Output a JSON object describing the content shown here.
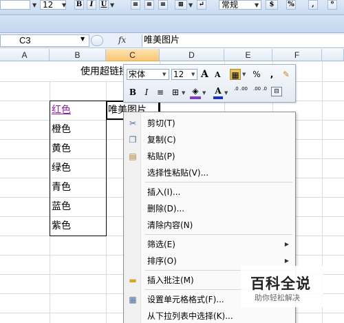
{
  "ribbon": {
    "font_size": "12",
    "bold": "B",
    "italic": "I",
    "underline": "U",
    "number_format": "常规",
    "percent": "%",
    "comma": ","
  },
  "formula_bar": {
    "name_box": "C3",
    "fx": "fx",
    "content": "唯美图片"
  },
  "columns": [
    "A",
    "B",
    "C",
    "D",
    "E",
    "F"
  ],
  "selected_column": "C",
  "sheet": {
    "title": "使用超链接",
    "items": [
      "红色",
      "橙色",
      "黄色",
      "绿色",
      "青色",
      "蓝色",
      "紫色"
    ],
    "active_cell": "唯美图片"
  },
  "mini_toolbar": {
    "font_name": "宋体",
    "font_size": "12",
    "grow_font": "A",
    "shrink_font": "A",
    "percent": "%",
    "comma": ",",
    "bold": "B",
    "italic": "I",
    "font_color": "A",
    "inc_decimal": ".0 .00",
    "dec_decimal": ".00 .0"
  },
  "context_menu": {
    "items": [
      {
        "label": "剪切(T)",
        "icon": "scissors-icon",
        "submenu": false
      },
      {
        "label": "复制(C)",
        "icon": "copy-icon",
        "submenu": false
      },
      {
        "label": "粘贴(P)",
        "icon": "paste-icon",
        "submenu": false
      },
      {
        "label": "选择性粘贴(V)...",
        "icon": "",
        "submenu": false
      },
      {
        "label": "插入(I)...",
        "icon": "",
        "submenu": false
      },
      {
        "label": "删除(D)...",
        "icon": "",
        "submenu": false
      },
      {
        "label": "清除内容(N)",
        "icon": "",
        "submenu": false
      },
      {
        "label": "筛选(E)",
        "icon": "",
        "submenu": true
      },
      {
        "label": "排序(O)",
        "icon": "",
        "submenu": true
      },
      {
        "label": "插入批注(M)",
        "icon": "comment-icon",
        "submenu": false
      },
      {
        "label": "设置单元格格式(F)...",
        "icon": "format-cells-icon",
        "submenu": false
      },
      {
        "label": "从下拉列表中选择(K)...",
        "icon": "",
        "submenu": false
      }
    ]
  },
  "watermark": {
    "title": "百科全说",
    "subtitle": "助你轻松解决"
  },
  "colors": {
    "hyperlink": "#8b1ea3",
    "selected_header": "#f9c774",
    "ribbon": "#c9daf0"
  }
}
